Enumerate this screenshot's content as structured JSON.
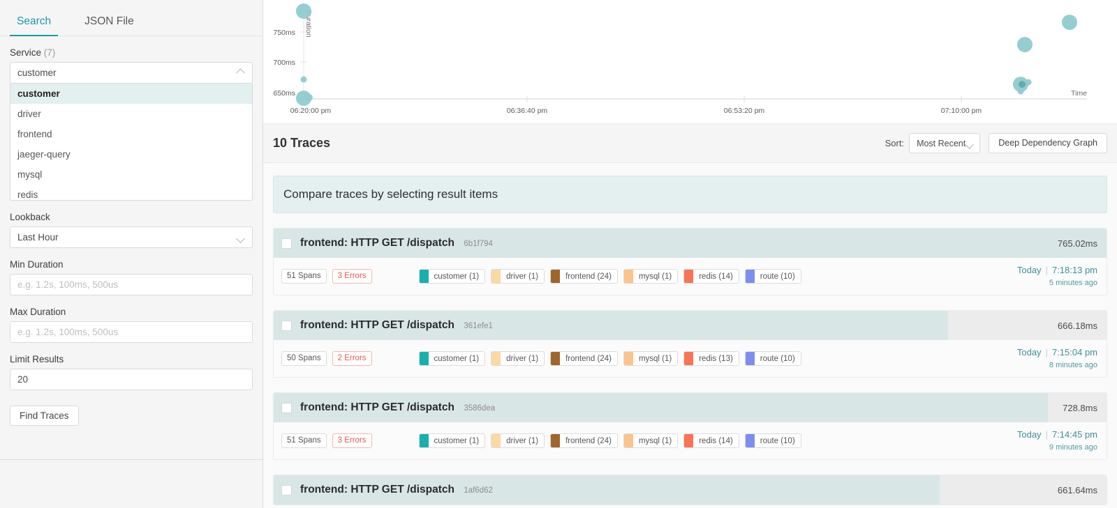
{
  "sidebar": {
    "tabs": [
      {
        "label": "Search",
        "active": true
      },
      {
        "label": "JSON File",
        "active": false
      }
    ],
    "service": {
      "label": "Service",
      "count": "(7)",
      "value": "customer",
      "options": [
        "customer",
        "driver",
        "frontend",
        "jaeger-query",
        "mysql",
        "redis"
      ]
    },
    "lookback": {
      "label": "Lookback",
      "value": "Last Hour"
    },
    "min_duration": {
      "label": "Min Duration",
      "value": "",
      "placeholder": "e.g. 1.2s, 100ms, 500us"
    },
    "max_duration": {
      "label": "Max Duration",
      "value": "",
      "placeholder": "e.g. 1.2s, 100ms, 500us"
    },
    "limit_results": {
      "label": "Limit Results",
      "value": "20"
    },
    "find_traces_label": "Find Traces"
  },
  "chart_data": {
    "type": "scatter",
    "title": "",
    "xlabel": "Time",
    "ylabel": "Duration",
    "xticks": [
      "06:20:00 pm",
      "06:36:40 pm",
      "06:53:20 pm",
      "07:10:00 pm"
    ],
    "yticks": [
      "650ms",
      "700ms",
      "750ms"
    ],
    "ylim": [
      630,
      790
    ],
    "grid": false,
    "point_color": "#8fcbcd",
    "points": [
      {
        "x": "06:20:05 pm",
        "y": 775,
        "r": 11
      },
      {
        "x": "06:20:05 pm",
        "y": 668,
        "r": 4
      },
      {
        "x": "06:20:05 pm",
        "y": 640,
        "r": 11
      },
      {
        "x": "06:20:20 pm",
        "y": 639,
        "r": 5
      },
      {
        "x": "07:18:13 pm",
        "y": 765,
        "r": 11
      },
      {
        "x": "07:14:45 pm",
        "y": 729,
        "r": 11
      },
      {
        "x": "07:14:30 pm",
        "y": 660,
        "r": 11
      },
      {
        "x": "07:15:04 pm",
        "y": 661,
        "r": 5
      },
      {
        "x": "07:15:30 pm",
        "y": 663,
        "r": 4
      },
      {
        "x": "07:14:40 pm",
        "y": 645,
        "r": 4
      }
    ]
  },
  "results": {
    "count_label": "10 Traces",
    "sort_label": "Sort:",
    "sort_value": "Most Recent",
    "ddg_button": "Deep Dependency Graph",
    "compare_banner": "Compare traces by selecting result items",
    "traces": [
      {
        "name": "frontend: HTTP GET /dispatch",
        "id": "6b1f794",
        "duration": "765.02ms",
        "bar_pct": 100,
        "spans": "51 Spans",
        "errors": "3 Errors",
        "services": [
          {
            "name": "customer (1)",
            "color": "#17b0ad"
          },
          {
            "name": "driver (1)",
            "color": "#fbd9a0"
          },
          {
            "name": "frontend (24)",
            "color": "#a1652a"
          },
          {
            "name": "mysql (1)",
            "color": "#fcc38a"
          },
          {
            "name": "redis (14)",
            "color": "#fa7453"
          },
          {
            "name": "route (10)",
            "color": "#7b8ff0"
          }
        ],
        "day": "Today",
        "time": "7:18:13 pm",
        "relative": "5 minutes ago"
      },
      {
        "name": "frontend: HTTP GET /dispatch",
        "id": "361efe1",
        "duration": "666.18ms",
        "bar_pct": 81,
        "spans": "50 Spans",
        "errors": "2 Errors",
        "services": [
          {
            "name": "customer (1)",
            "color": "#17b0ad"
          },
          {
            "name": "driver (1)",
            "color": "#fbd9a0"
          },
          {
            "name": "frontend (24)",
            "color": "#a1652a"
          },
          {
            "name": "mysql (1)",
            "color": "#fcc38a"
          },
          {
            "name": "redis (13)",
            "color": "#fa7453"
          },
          {
            "name": "route (10)",
            "color": "#7b8ff0"
          }
        ],
        "day": "Today",
        "time": "7:15:04 pm",
        "relative": "8 minutes ago"
      },
      {
        "name": "frontend: HTTP GET /dispatch",
        "id": "3586dea",
        "duration": "728.8ms",
        "bar_pct": 93,
        "spans": "51 Spans",
        "errors": "3 Errors",
        "services": [
          {
            "name": "customer (1)",
            "color": "#17b0ad"
          },
          {
            "name": "driver (1)",
            "color": "#fbd9a0"
          },
          {
            "name": "frontend (24)",
            "color": "#a1652a"
          },
          {
            "name": "mysql (1)",
            "color": "#fcc38a"
          },
          {
            "name": "redis (14)",
            "color": "#fa7453"
          },
          {
            "name": "route (10)",
            "color": "#7b8ff0"
          }
        ],
        "day": "Today",
        "time": "7:14:45 pm",
        "relative": "9 minutes ago"
      },
      {
        "name": "frontend: HTTP GET /dispatch",
        "id": "1af6d62",
        "duration": "661.64ms",
        "bar_pct": 80,
        "spans": "",
        "errors": "",
        "services": [],
        "day": "",
        "time": "",
        "relative": ""
      }
    ]
  },
  "colors": {
    "accent": "#1a9aa5",
    "banner_bg": "#e4f0ef",
    "bar_bg": "#d9e6e6",
    "error": "#e8584c"
  }
}
